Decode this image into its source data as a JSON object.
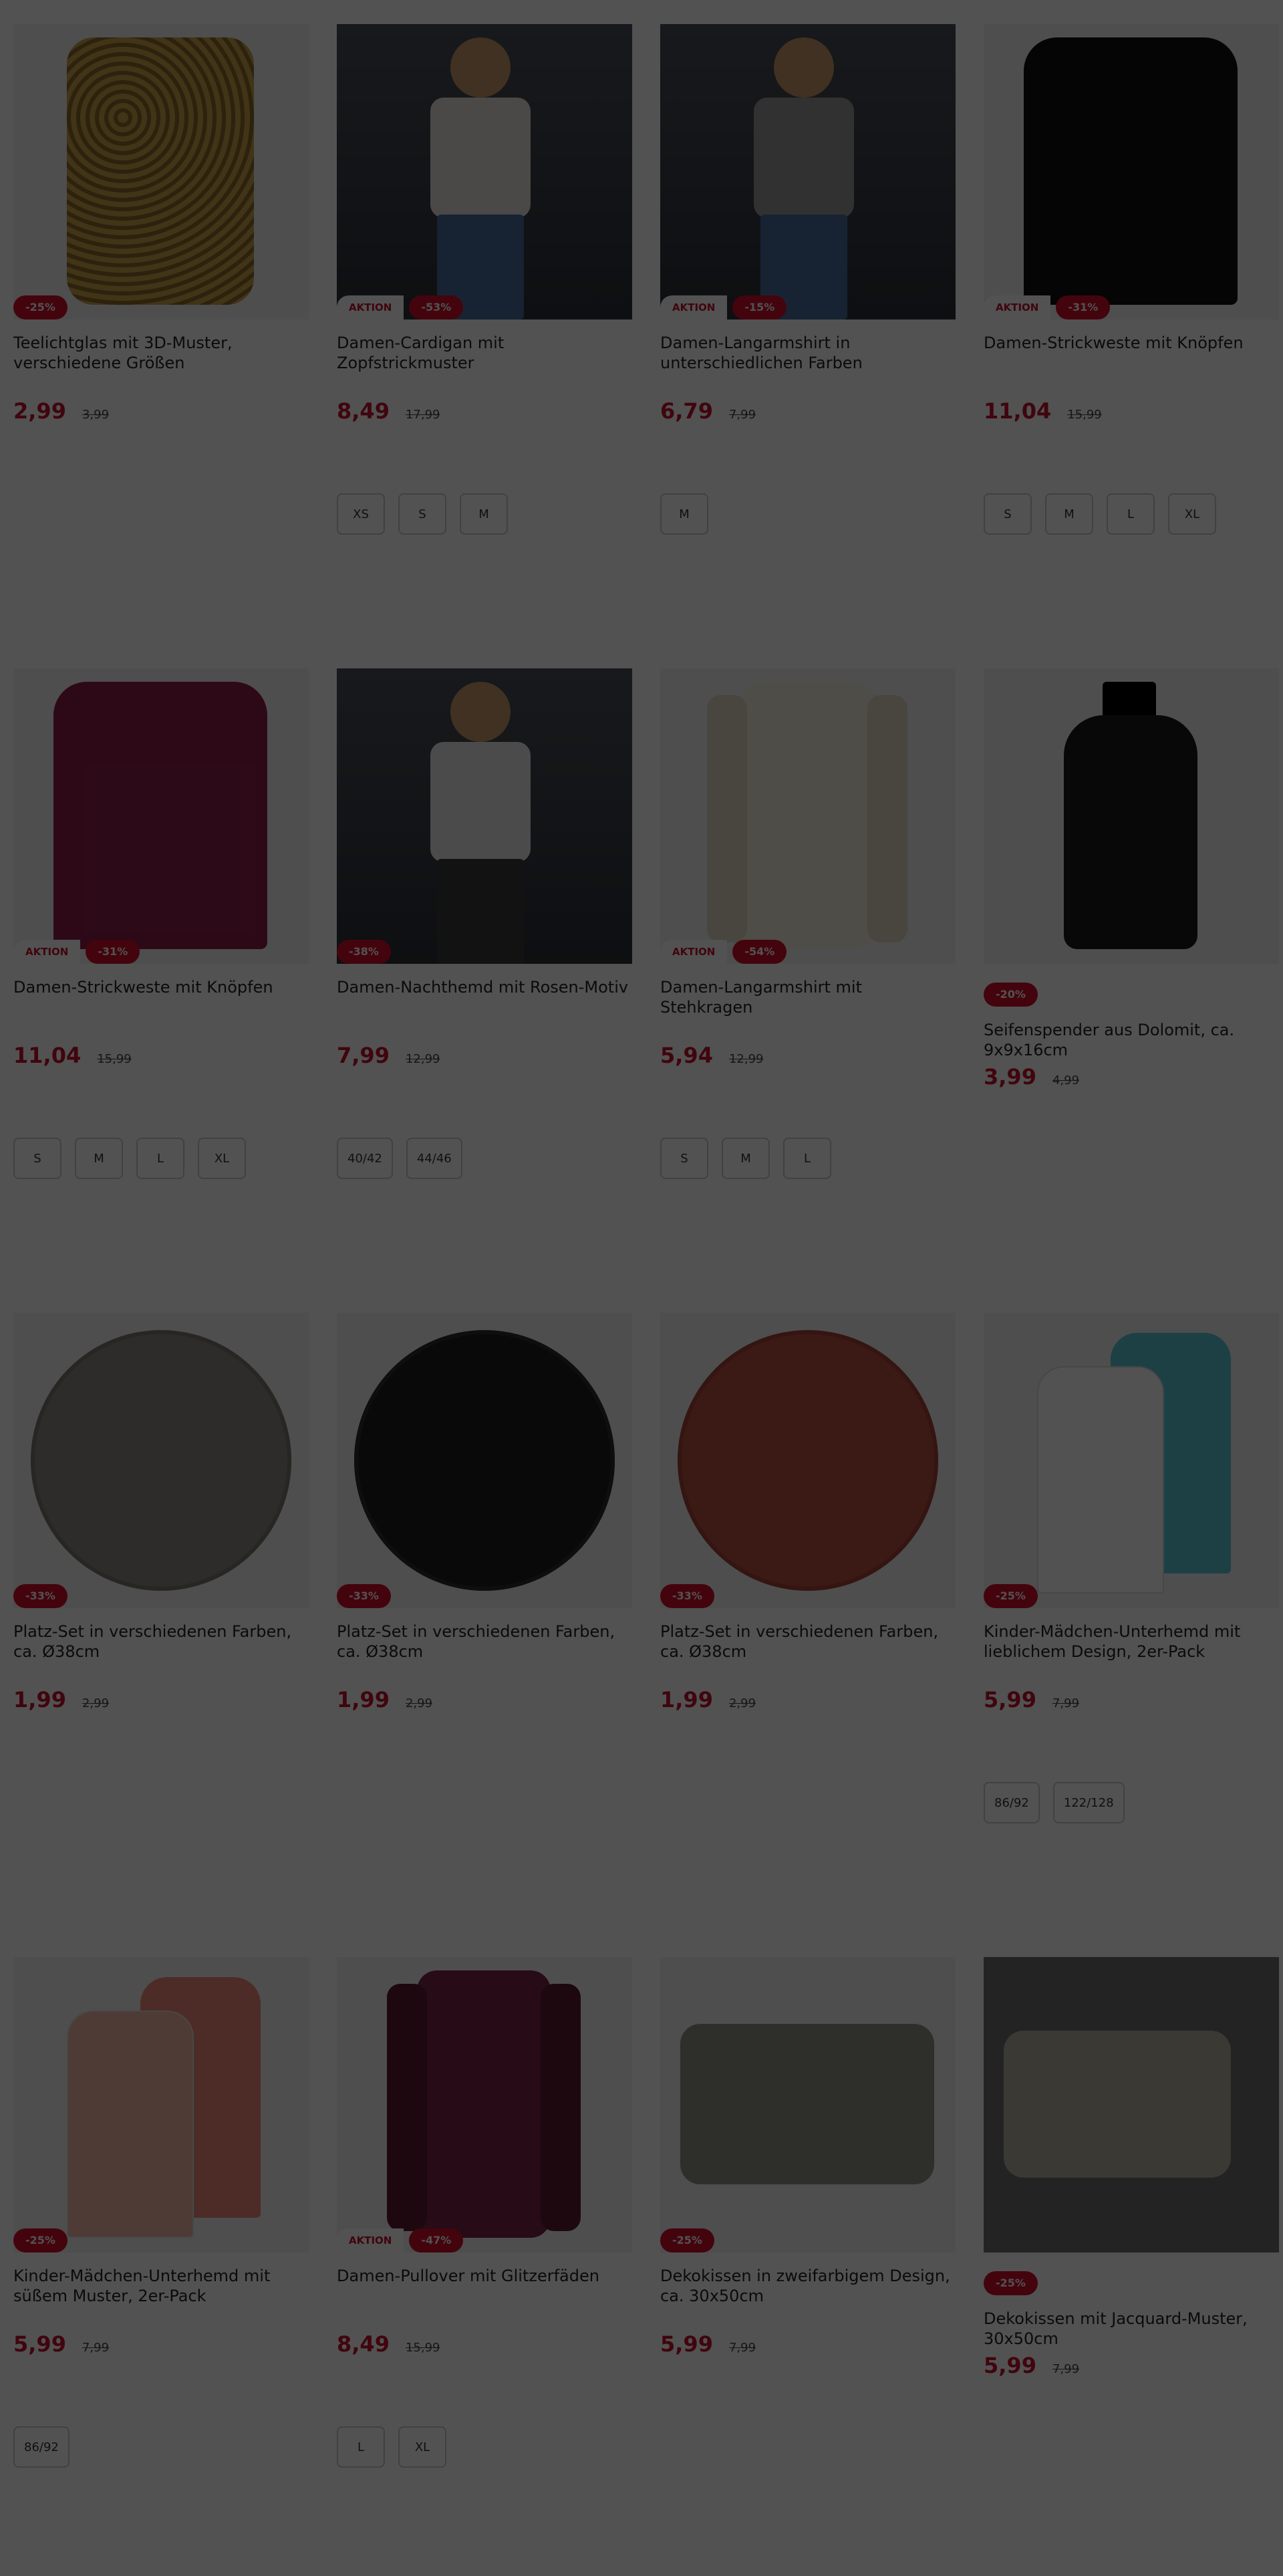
{
  "products": [
    {
      "title": "Teelichtglas mit 3D-Muster, verschiedene Größen",
      "aktion": "",
      "discount": "-25%",
      "price": "2,99",
      "old_price": "3,99",
      "sizes": [],
      "art": "candle",
      "colors": {
        "main": "#c9a24a",
        "accent": "#8a6a2a"
      }
    },
    {
      "title": "Damen-Cardigan mit Zopfstrickmuster",
      "aktion": "AKTION",
      "discount": "-53%",
      "price": "8,49",
      "old_price": "17,99",
      "sizes": [
        "XS",
        "S",
        "M"
      ],
      "art": "photo-cardigan",
      "colors": {
        "main": "#e8e4dc",
        "accent": "#4a6fa0"
      }
    },
    {
      "title": "Damen-Langarmshirt in unterschiedlichen Farben",
      "aktion": "AKTION",
      "discount": "-15%",
      "price": "6,79",
      "old_price": "7,99",
      "sizes": [
        "M"
      ],
      "art": "photo-shirt",
      "colors": {
        "main": "#9a9a9a",
        "accent": "#4a6fa0"
      }
    },
    {
      "title": "Damen-Strickweste mit Knöpfen",
      "aktion": "AKTION",
      "discount": "-31%",
      "price": "11,04",
      "old_price": "15,99",
      "sizes": [
        "S",
        "M",
        "L",
        "XL"
      ],
      "art": "vest-black",
      "colors": {
        "main": "#111111",
        "accent": "#222222"
      }
    },
    {
      "title": "Damen-Strickweste mit Knöpfen",
      "aktion": "AKTION",
      "discount": "-31%",
      "price": "11,04",
      "old_price": "15,99",
      "sizes": [
        "S",
        "M",
        "L",
        "XL"
      ],
      "art": "vest-berry",
      "colors": {
        "main": "#8b1e4a",
        "accent": "#6a1538"
      }
    },
    {
      "title": "Damen-Nachthemd mit Rosen-Motiv",
      "aktion": "",
      "discount": "-38%",
      "price": "7,99",
      "old_price": "12,99",
      "sizes": [
        "40/42",
        "44/46"
      ],
      "art": "photo-nightdress",
      "colors": {
        "main": "#e9e9e9",
        "accent": "#3a3a3a"
      }
    },
    {
      "title": "Damen-Langarmshirt mit Stehkragen",
      "aktion": "AKTION",
      "discount": "-54%",
      "price": "5,94",
      "old_price": "12,99",
      "sizes": [
        "S",
        "M",
        "L"
      ],
      "art": "longsleeve-cream",
      "colors": {
        "main": "#f4eedf",
        "accent": "#e2dac6"
      }
    },
    {
      "title": "Seifenspender aus Dolomit, ca. 9x9x16cm",
      "aktion": "",
      "discount": "-20%",
      "price": "3,99",
      "old_price": "4,99",
      "sizes": [],
      "art": "dispenser",
      "colors": {
        "main": "#1a1a1a",
        "accent": "#000000"
      }
    },
    {
      "title": "Platz-Set in verschiedenen Farben, ca. Ø38cm",
      "aktion": "",
      "discount": "-33%",
      "price": "1,99",
      "old_price": "2,99",
      "sizes": [],
      "art": "mat",
      "colors": {
        "main": "#8c8a82",
        "accent": "#7a786f"
      }
    },
    {
      "title": "Platz-Set in verschiedenen Farben, ca. Ø38cm",
      "aktion": "",
      "discount": "-33%",
      "price": "1,99",
      "old_price": "2,99",
      "sizes": [],
      "art": "mat",
      "colors": {
        "main": "#1e1e1e",
        "accent": "#2c2c2c"
      }
    },
    {
      "title": "Platz-Set in verschiedenen Farben, ca. Ø38cm",
      "aktion": "",
      "discount": "-33%",
      "price": "1,99",
      "old_price": "2,99",
      "sizes": [],
      "art": "mat",
      "colors": {
        "main": "#b94f3f",
        "accent": "#a24335"
      }
    },
    {
      "title": "Kinder-Mädchen-Unterhemd mit lieblichem Design, 2er-Pack",
      "aktion": "",
      "discount": "-25%",
      "price": "5,99",
      "old_price": "7,99",
      "sizes": [
        "86/92",
        "122/128"
      ],
      "art": "tanks-blue",
      "colors": {
        "main": "#ffffff",
        "accent": "#5cc7d6"
      }
    },
    {
      "title": "Kinder-Mädchen-Unterhemd mit süßem Muster, 2er-Pack",
      "aktion": "",
      "discount": "-25%",
      "price": "5,99",
      "old_price": "7,99",
      "sizes": [
        "86/92"
      ],
      "art": "tanks-pink",
      "colors": {
        "main": "#f3b6a8",
        "accent": "#f08a7a"
      }
    },
    {
      "title": "Damen-Pullover mit Glitzerfäden",
      "aktion": "AKTION",
      "discount": "-47%",
      "price": "8,49",
      "old_price": "15,99",
      "sizes": [
        "L",
        "XL"
      ],
      "art": "pullover",
      "colors": {
        "main": "#7a2545",
        "accent": "#5a1a33"
      }
    },
    {
      "title": "Dekokissen in zweifarbigem Design, ca. 30x50cm",
      "aktion": "",
      "discount": "-25%",
      "price": "5,99",
      "old_price": "7,99",
      "sizes": [],
      "art": "cushion",
      "colors": {
        "main": "#8e8e86",
        "accent": "#7a7a72"
      }
    },
    {
      "title": "Dekokissen mit Jacquard-Muster, 30x50cm",
      "aktion": "",
      "discount": "-25%",
      "price": "5,99",
      "old_price": "7,99",
      "sizes": [],
      "art": "photo-cushion",
      "colors": {
        "main": "#b8b2a2",
        "accent": "#6f6f6f"
      }
    }
  ]
}
